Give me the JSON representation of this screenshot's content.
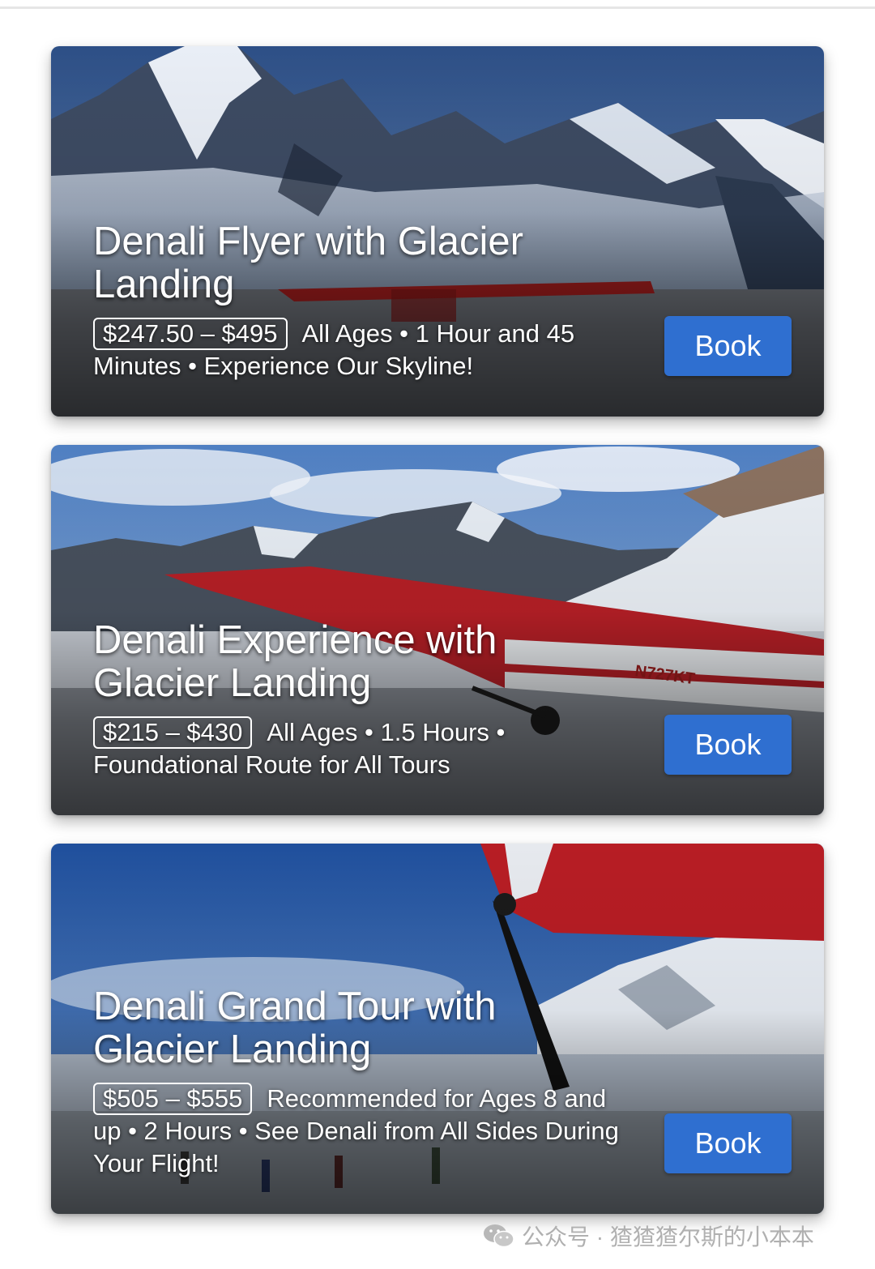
{
  "tours": [
    {
      "title": "Denali Flyer with Glacier Landing",
      "price": "$247.50 – $495",
      "details": "All Ages • 1 Hour and 45 Minutes • Experience Our Skyline!",
      "button_label": "Book"
    },
    {
      "title": "Denali Experience with Glacier Landing",
      "price": "$215 – $430",
      "details": "All Ages • 1.5 Hours • Foundational Route for All Tours",
      "button_label": "Book"
    },
    {
      "title": "Denali Grand Tour with Glacier Landing",
      "price": "$505 – $555",
      "details": "Recommended for Ages 8 and up • 2 Hours • See Denali from All Sides During Your Flight!",
      "button_label": "Book"
    }
  ],
  "watermark": {
    "text": "公众号 · 猹猹猹尔斯的小本本",
    "icon": "wechat-icon"
  },
  "colors": {
    "button": "#2f6fd0",
    "text": "#ffffff"
  }
}
